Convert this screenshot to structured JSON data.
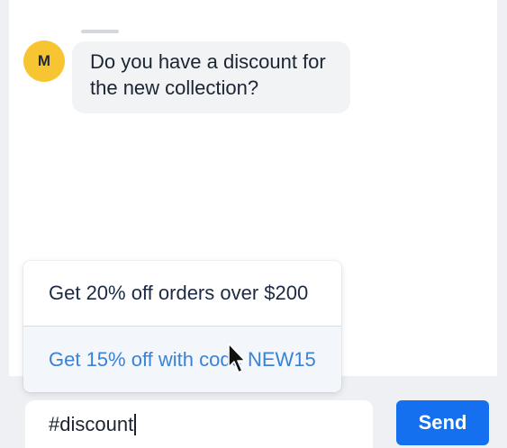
{
  "chat": {
    "avatar_initial": "M",
    "message": "Do you have a discount for the new collection?"
  },
  "suggestions": [
    {
      "label": "Get 20% off orders over $200"
    },
    {
      "label": "Get 15% off with code NEW15"
    }
  ],
  "composer": {
    "input_value": "#discount",
    "send_label": "Send"
  },
  "colors": {
    "avatar": "#f7c531",
    "send_button": "#1570ef",
    "highlight_text": "#3b82d6"
  },
  "icons": {
    "cursor": "mouse-pointer-icon"
  }
}
